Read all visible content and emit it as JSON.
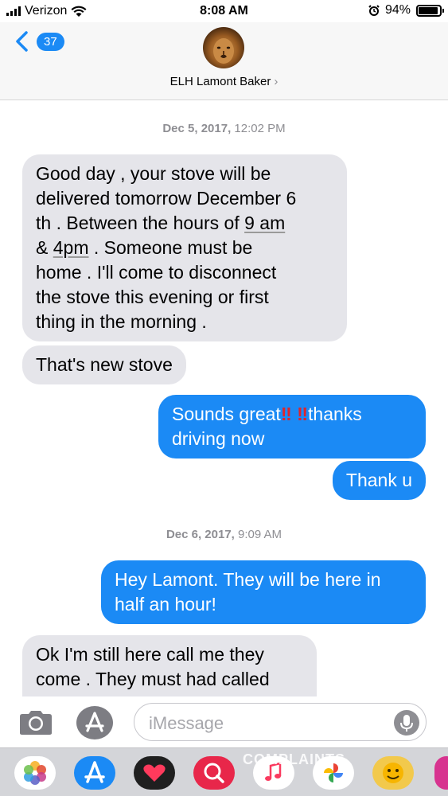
{
  "status": {
    "carrier": "Verizon",
    "time": "8:08 AM",
    "battery": "94%"
  },
  "header": {
    "back_count": "37",
    "contact_name": "ELH Lamont Baker",
    "name_chevron": "›"
  },
  "conversation": {
    "timestamp1_date": "Dec 5, 2017,",
    "timestamp1_time": "12:02 PM",
    "msg1": {
      "l1": "Good day , your stove will be",
      "l2": "delivered tomorrow December 6",
      "l3a": "th . Between the hours of ",
      "l3b": "9 am",
      "l4a": "& ",
      "l4b": "4pm",
      "l4c": " . Someone must be",
      "l5": "home . I'll come to disconnect",
      "l6": "the stove this evening or first",
      "l7": "thing in the morning ."
    },
    "msg2": "That's new stove",
    "msg3": {
      "l1a": "Sounds great",
      "bang1": "‼",
      "bang2": "‼",
      "l1b": "thanks",
      "l2": "driving now"
    },
    "msg4": "Thank u",
    "timestamp2_date": "Dec 6, 2017,",
    "timestamp2_time": "9:09 AM",
    "msg5": {
      "l1": "Hey Lamont. They will be here in",
      "l2": "half an hour!"
    },
    "msg6": {
      "l1": "Ok I'm still here call me they",
      "l2": "come . They must had called"
    }
  },
  "input": {
    "placeholder": "iMessage"
  },
  "watermark": "COMPLAINTS",
  "colors": {
    "outgoing_bubble": "#1b8af5",
    "incoming_bubble": "#e5e5ea",
    "drawer_bg": "#d4d5d9"
  },
  "icons": [
    "signal-icon",
    "wifi-icon",
    "alarm-icon",
    "battery-icon",
    "chevron-left-icon",
    "camera-icon",
    "app-store-icon",
    "microphone-icon",
    "photos-icon",
    "digital-touch-icon",
    "search-images-icon",
    "music-icon",
    "google-photos-icon",
    "emoji-sticker-icon"
  ]
}
